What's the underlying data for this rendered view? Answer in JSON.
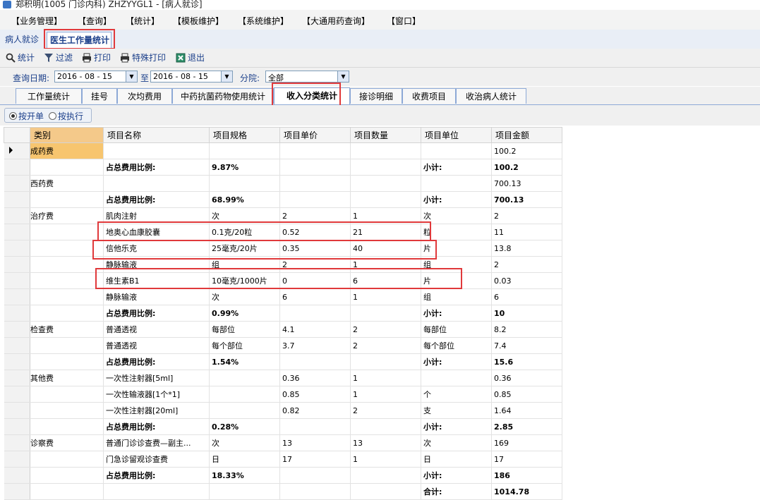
{
  "window": {
    "title": "郑积明(1005 门诊内科) ZHZYYGL1 - [病人就诊]"
  },
  "menu": [
    "【业务管理】",
    "【查询】",
    "【统计】",
    "【模板维护】",
    "【系统维护】",
    "【大通用药查询】",
    "【窗口】"
  ],
  "doc_tabs": {
    "inactive": "病人就诊",
    "active": "医生工作量统计"
  },
  "toolbar": {
    "stat": "统计",
    "filter": "过滤",
    "print": "打印",
    "special_print": "特殊打印",
    "exit": "退出"
  },
  "query": {
    "date_label": "查询日期:",
    "date_from": "2016 - 08 - 15",
    "to_label": "至",
    "date_to": "2016 - 08 - 15",
    "branch_label": "分院:",
    "branch_value": "全部"
  },
  "subtabs": [
    "工作量统计",
    "挂号",
    "次均费用",
    "中药抗菌药物使用统计",
    "收入分类统计",
    "接诊明细",
    "收费项目",
    "收治病人统计"
  ],
  "radio": {
    "by_order": "按开单",
    "by_exec": "按执行"
  },
  "grid": {
    "columns": [
      "类别",
      "项目名称",
      "项目规格",
      "项目单价",
      "项目数量",
      "项目单位",
      "项目金额"
    ],
    "rows": [
      [
        "成药费",
        "",
        "",
        "",
        "",
        "",
        "100.2"
      ],
      [
        "",
        "占总费用比例:",
        "9.87%",
        "",
        "",
        "小计:",
        "100.2"
      ],
      [
        "西药费",
        "",
        "",
        "",
        "",
        "",
        "700.13"
      ],
      [
        "",
        "占总费用比例:",
        "68.99%",
        "",
        "",
        "小计:",
        "700.13"
      ],
      [
        "治疗费",
        "肌肉注射",
        "次",
        "2",
        "1",
        "次",
        "2"
      ],
      [
        "",
        "地奥心血康胶囊",
        "0.1克/20粒",
        "0.52",
        "21",
        "粒",
        "11"
      ],
      [
        "",
        "信他乐克",
        "25毫克/20片",
        "0.35",
        "40",
        "片",
        "13.8"
      ],
      [
        "",
        "静脉输液",
        "组",
        "2",
        "1",
        "组",
        "2"
      ],
      [
        "",
        "维生素B1",
        "10毫克/1000片",
        "0",
        "6",
        "片",
        "0.03"
      ],
      [
        "",
        "静脉输液",
        "次",
        "6",
        "1",
        "组",
        "6"
      ],
      [
        "",
        "占总费用比例:",
        "0.99%",
        "",
        "",
        "小计:",
        "10"
      ],
      [
        "检查费",
        "普通透视",
        "每部位",
        "4.1",
        "2",
        "每部位",
        "8.2"
      ],
      [
        "",
        "普通透视",
        "每个部位",
        "3.7",
        "2",
        "每个部位",
        "7.4"
      ],
      [
        "",
        "占总费用比例:",
        "1.54%",
        "",
        "",
        "小计:",
        "15.6"
      ],
      [
        "其他费",
        "一次性注射器[5ml]",
        "",
        "0.36",
        "1",
        "",
        "0.36"
      ],
      [
        "",
        "一次性输液器[1个*1]",
        "",
        "0.85",
        "1",
        "个",
        "0.85"
      ],
      [
        "",
        "一次性注射器[20ml]",
        "",
        "0.82",
        "2",
        "支",
        "1.64"
      ],
      [
        "",
        "占总费用比例:",
        "0.28%",
        "",
        "",
        "小计:",
        "2.85"
      ],
      [
        "诊察费",
        "普通门诊诊查费—副主...",
        "次",
        "13",
        "13",
        "次",
        "169"
      ],
      [
        "",
        "门急诊留观诊查费",
        "日",
        "17",
        "1",
        "日",
        "17"
      ],
      [
        "",
        "占总费用比例:",
        "18.33%",
        "",
        "",
        "小计:",
        "186"
      ],
      [
        "",
        "",
        "",
        "",
        "",
        "合计:",
        "1014.78"
      ]
    ]
  }
}
